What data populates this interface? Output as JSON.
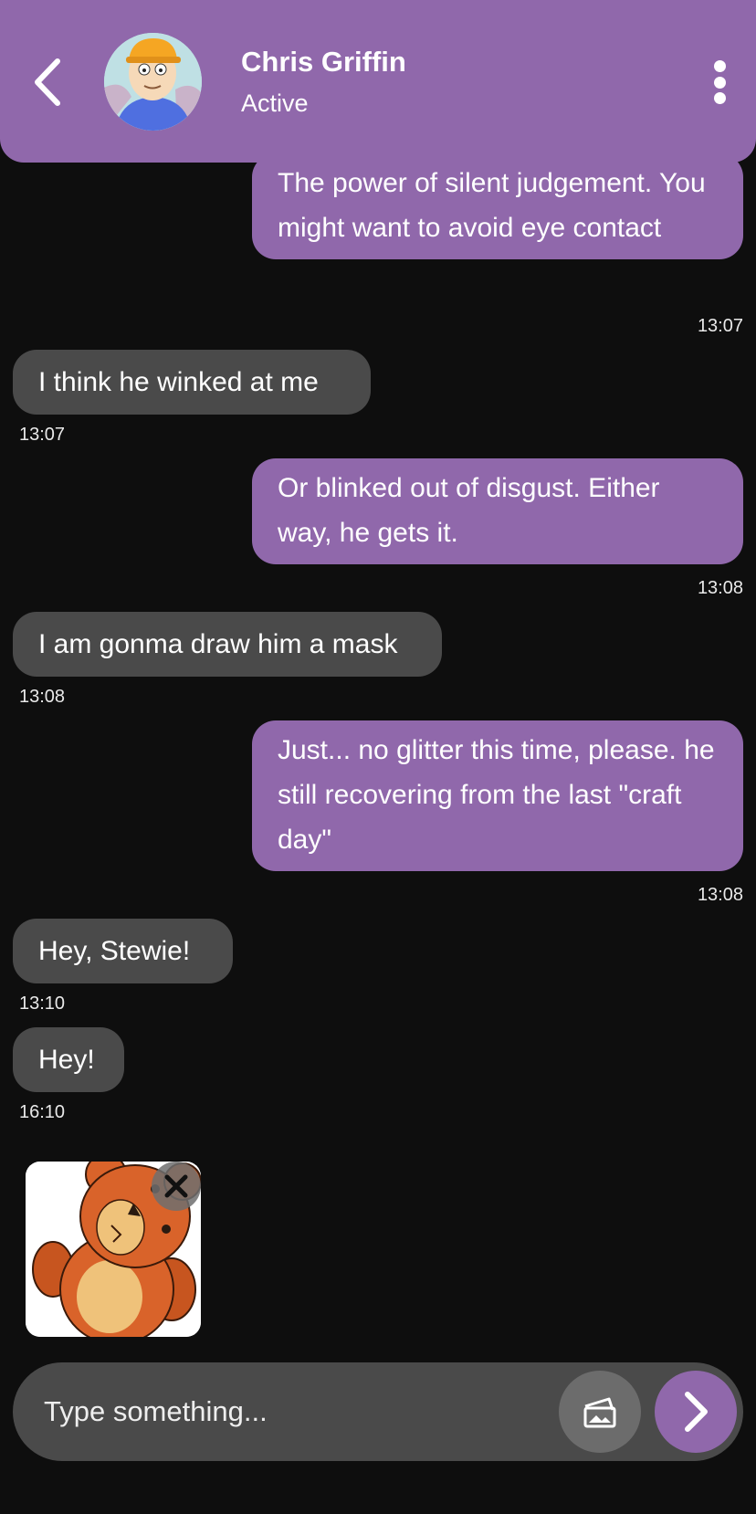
{
  "header": {
    "contact_name": "Chris Griffin",
    "status": "Active",
    "back_icon": "chevron-left-icon",
    "menu_icon": "more-vertical-icon",
    "avatar_icon": "contact-avatar"
  },
  "messages": [
    {
      "direction": "outgoing",
      "text": "The power of silent judgement. You might want to avoid eye contact",
      "time": "13:07"
    },
    {
      "direction": "incoming",
      "text": "I think he winked at me",
      "time": "13:07"
    },
    {
      "direction": "outgoing",
      "text": "Or blinked out of disgust. Either way, he gets it.",
      "time": "13:08"
    },
    {
      "direction": "incoming",
      "text": "I am gonma draw him a mask",
      "time": "13:08"
    },
    {
      "direction": "outgoing",
      "text": "Just... no glitter this time, please. he still recovering from the last \"craft day\"",
      "time": "13:08"
    },
    {
      "direction": "incoming",
      "text": "Hey, Stewie!",
      "time": "13:10"
    },
    {
      "direction": "incoming",
      "text": "Hey!",
      "time": "16:10"
    }
  ],
  "attachment": {
    "image_icon": "teddy-bear-image",
    "remove_icon": "close-icon"
  },
  "composer": {
    "placeholder": "Type something...",
    "value": "",
    "attach_icon": "image-attach-icon",
    "send_icon": "chevron-right-icon"
  },
  "colors": {
    "accent": "#9068ab",
    "background": "#0e0e0e",
    "incoming_bubble": "#4a4a4a",
    "input_background": "#4a4a4a"
  }
}
